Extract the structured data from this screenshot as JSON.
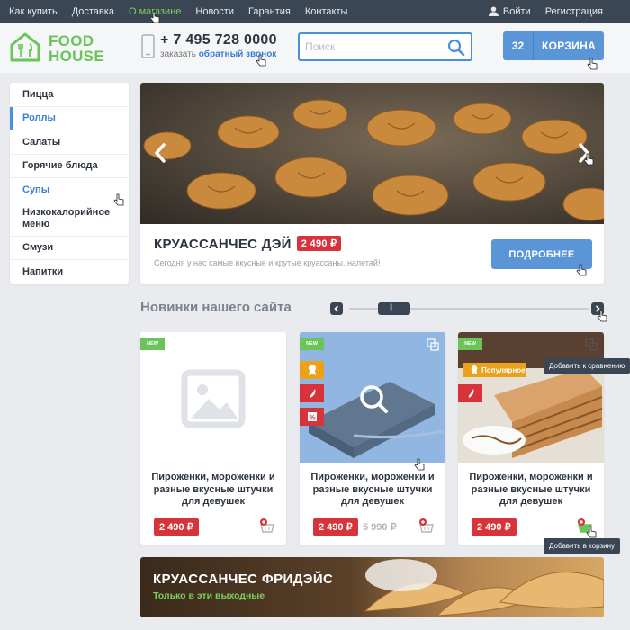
{
  "topbar": {
    "nav": [
      "Как купить",
      "Доставка",
      "О магазине",
      "Новости",
      "Гарантия",
      "Контакты"
    ],
    "active_index": 2,
    "login": "Войти",
    "register": "Регистрация"
  },
  "header": {
    "logo_line1": "FOOD",
    "logo_line2": "HOUSE",
    "phone": "+ 7 495 728 0000",
    "callback_prefix": "заказать",
    "callback_link": "обратный звонок",
    "search_placeholder": "Поиск",
    "cart_count": "32",
    "cart_label": "КОРЗИНА"
  },
  "sidebar": {
    "items": [
      "Пицца",
      "Роллы",
      "Салаты",
      "Горячие блюда",
      "Супы",
      "Низкокалорийное меню",
      "Смузи",
      "Напитки"
    ]
  },
  "banner": {
    "title": "КРУАССАНЧЕС ДЭЙ",
    "price": "2 490 ₽",
    "description": "Сегодня у нас самые вкусные и крутые круассаны, налетай!",
    "button": "ПОДРОБНЕЕ"
  },
  "new_items": {
    "title": "Новинки нашего сайта",
    "cards": [
      {
        "name": "Пироженки, мороженки и разные вкусные штучки для девушек",
        "price": "2 490 ₽",
        "old_price": "",
        "badge": "NEW"
      },
      {
        "name": "Пироженки, мороженки и разные вкусные штучки для девушек",
        "price": "2 490 ₽",
        "old_price": "5 990 ₽",
        "badge": "NEW"
      },
      {
        "name": "Пироженки, мороженки и разные вкусные штучки для девушек",
        "price": "2 490 ₽",
        "old_price": "",
        "badge": "NEW",
        "popular": "Популярное"
      }
    ],
    "tooltip_compare": "Добавить к сравнению",
    "tooltip_cart": "Добавить в корзину"
  },
  "bottom_banner": {
    "title": "КРУАССАНЧЕС ФРИДЭЙС",
    "subtitle": "Только в эти выходные"
  },
  "colors": {
    "topbar": "#3a4654",
    "accent_green": "#6bc45a",
    "accent_blue": "#5a95d8",
    "price_red": "#d8323a",
    "popular_orange": "#eaa21a"
  }
}
